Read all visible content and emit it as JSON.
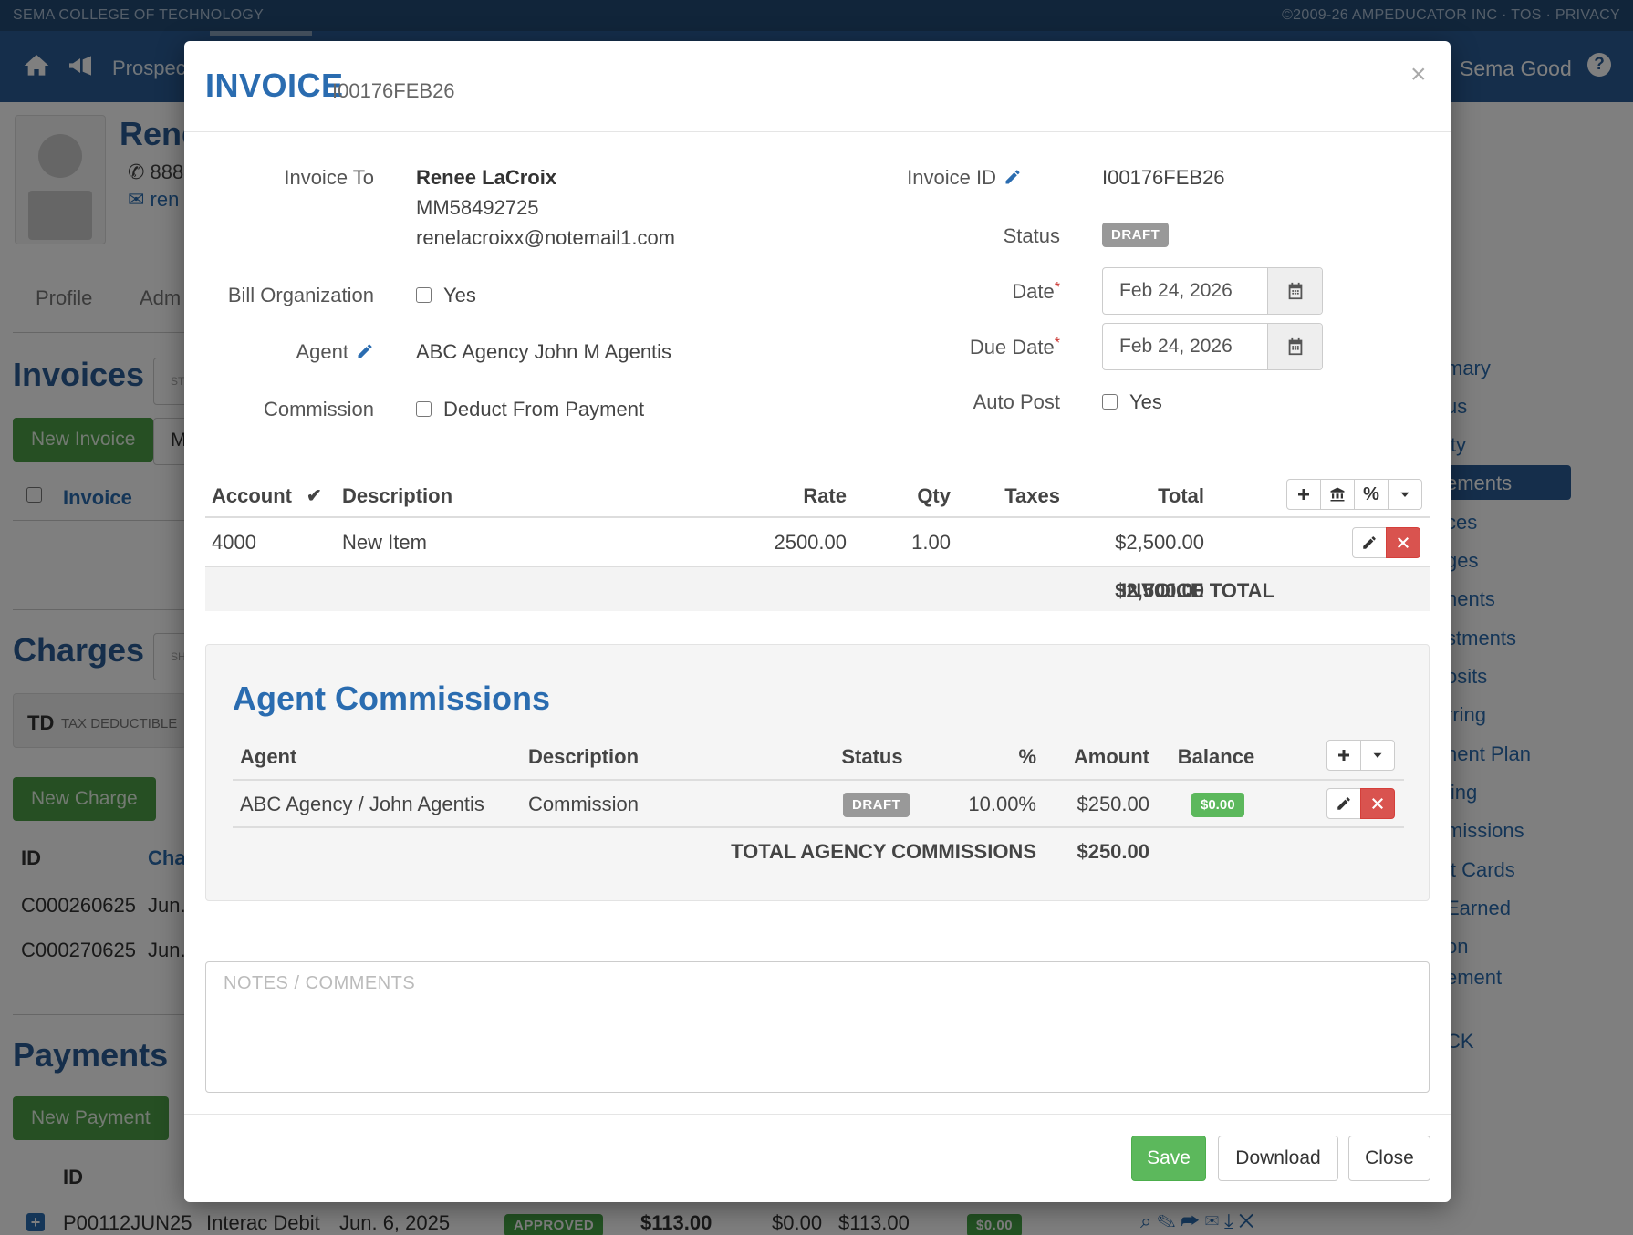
{
  "topstrip": {
    "org": "SEMA COLLEGE OF TECHNOLOGY",
    "copyright": "©2009-26 AMPEDUCATOR INC",
    "tos": "TOS",
    "privacy": "PRIVACY",
    "sep": "·"
  },
  "navbar": {
    "prospects": "Prospec",
    "user": "Sema Good",
    "help": "?"
  },
  "background": {
    "student_name": "Rene",
    "phone": "888",
    "email": "ren",
    "tabs": [
      "Profile",
      "Adm"
    ],
    "invoices_heading": "Invoices",
    "invoices_search": "ST",
    "new_invoice": "New Invoice",
    "more_btn": "M",
    "invoice_col": "Invoice",
    "charges_heading": "Charges",
    "charges_search": "SH",
    "td_label": "TD",
    "td_desc": "TAX DEDUCTIBLE",
    "new_charge": "New Charge",
    "charges_id_col": "ID",
    "charges_cha_col": "Cha",
    "charges_rows": [
      {
        "id": "C000260625",
        "date": "Jun."
      },
      {
        "id": "C000270625",
        "date": "Jun."
      }
    ],
    "payments_heading": "Payments",
    "new_payment": "New Payment",
    "payments_id_col": "ID",
    "payment_row": {
      "id": "P00112JUN25",
      "method": "Interac Debit",
      "date": "Jun. 6, 2025",
      "status": "APPROVED",
      "amount": "$113.00",
      "fee": "$0.00",
      "net": "$113.00",
      "balance": "$0.00"
    },
    "side_links": [
      "mary",
      "us",
      "ity",
      "ements",
      "ces",
      "ges",
      "nents",
      "stments",
      "osits",
      "rring",
      "nent Plan",
      "ling",
      "missions",
      "it Cards",
      "Earned",
      "on",
      "ement",
      "CK"
    ]
  },
  "modal": {
    "title": "INVOICE",
    "subtitle": "I00176FEB26",
    "close": "×",
    "invoice_to_label": "Invoice To",
    "invoice_to_name": "Renee LaCroix",
    "invoice_to_id": "MM58492725",
    "invoice_to_email": "renelacroixx@notemail1.com",
    "bill_org_label": "Bill Organization",
    "bill_org_option": "Yes",
    "agent_label": "Agent",
    "agent_value": "ABC Agency John M Agentis",
    "commission_label": "Commission",
    "commission_option": "Deduct From Payment",
    "invoice_id_label": "Invoice ID",
    "invoice_id_value": "I00176FEB26",
    "status_label": "Status",
    "status_value": "DRAFT",
    "date_label": "Date",
    "date_value": "Feb 24, 2026",
    "due_date_label": "Due Date",
    "due_date_value": "Feb 24, 2026",
    "auto_post_label": "Auto Post",
    "auto_post_option": "Yes",
    "required_mark": "*"
  },
  "items_table": {
    "headers": {
      "account": "Account",
      "description": "Description",
      "rate": "Rate",
      "qty": "Qty",
      "taxes": "Taxes",
      "total": "Total"
    },
    "rows": [
      {
        "account": "4000",
        "description": "New Item",
        "rate": "2500.00",
        "qty": "1.00",
        "taxes": "",
        "total": "$2,500.00"
      }
    ],
    "total_label": "INVOICE TOTAL",
    "total_value": "$2,500.00"
  },
  "commissions": {
    "title": "Agent Commissions",
    "headers": {
      "agent": "Agent",
      "description": "Description",
      "status": "Status",
      "percent": "%",
      "amount": "Amount",
      "balance": "Balance"
    },
    "rows": [
      {
        "agent": "ABC Agency / John Agentis",
        "description": "Commission",
        "status": "DRAFT",
        "percent": "10.00%",
        "amount": "$250.00",
        "balance": "$0.00"
      }
    ],
    "total_label": "TOTAL AGENCY COMMISSIONS",
    "total_value": "$250.00"
  },
  "notes": {
    "placeholder": "NOTES / COMMENTS"
  },
  "footer": {
    "save": "Save",
    "download": "Download",
    "close": "Close"
  },
  "colors": {
    "brand": "#2a5d97",
    "accent": "#2a6cb0",
    "success": "#5cb85c",
    "danger": "#d9534f"
  }
}
